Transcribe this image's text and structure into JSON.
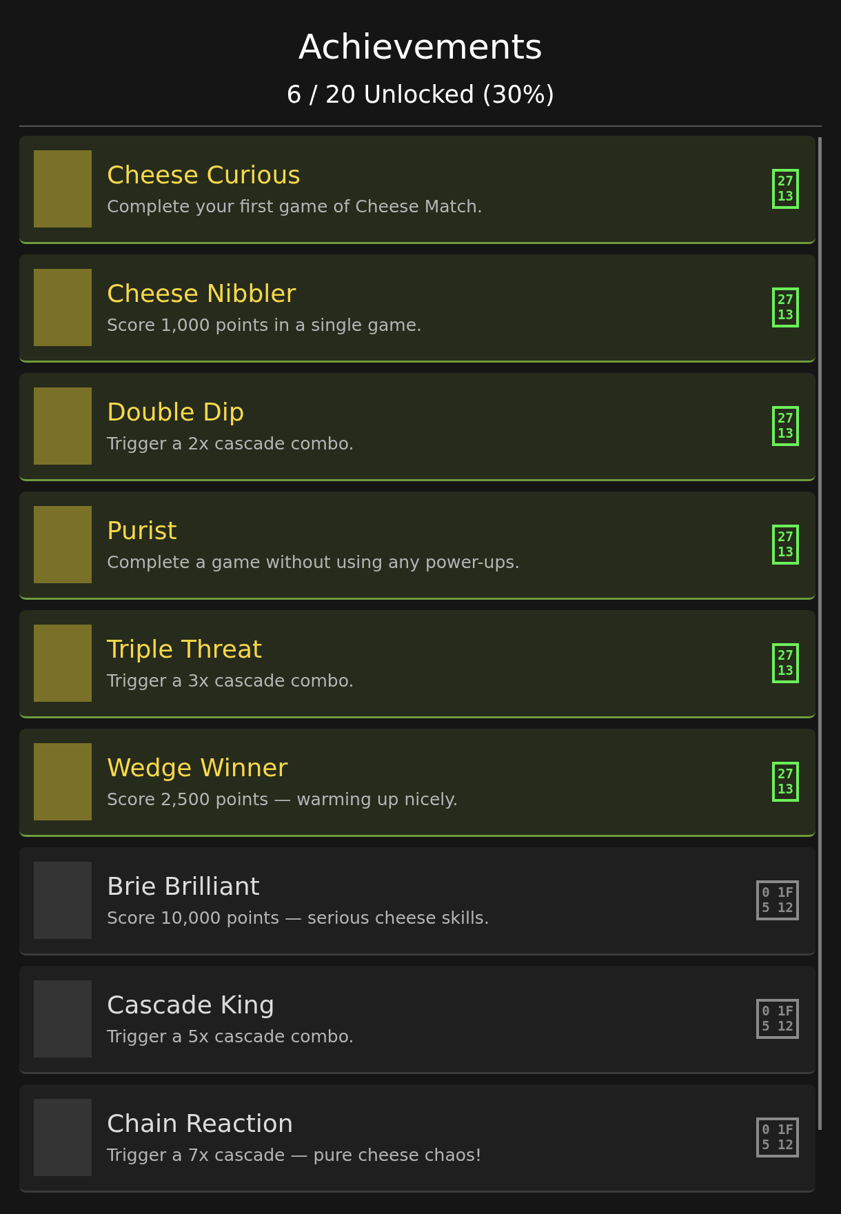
{
  "header": {
    "title": "Achievements",
    "progress": "6 / 20 Unlocked (30%)"
  },
  "achievements": [
    {
      "name": "Cheese Curious",
      "description": "Complete your first game of Cheese Match.",
      "unlocked": true,
      "glyph_code": [
        "27",
        "13"
      ]
    },
    {
      "name": "Cheese Nibbler",
      "description": "Score 1,000 points in a single game.",
      "unlocked": true,
      "glyph_code": [
        "27",
        "13"
      ]
    },
    {
      "name": "Double Dip",
      "description": "Trigger a 2x cascade combo.",
      "unlocked": true,
      "glyph_code": [
        "27",
        "13"
      ]
    },
    {
      "name": "Purist",
      "description": "Complete a game without using any power-ups.",
      "unlocked": true,
      "glyph_code": [
        "27",
        "13"
      ]
    },
    {
      "name": "Triple Threat",
      "description": "Trigger a 3x cascade combo.",
      "unlocked": true,
      "glyph_code": [
        "27",
        "13"
      ]
    },
    {
      "name": "Wedge Winner",
      "description": "Score 2,500 points — warming up nicely.",
      "unlocked": true,
      "glyph_code": [
        "27",
        "13"
      ]
    },
    {
      "name": "Brie Brilliant",
      "description": "Score 10,000 points — serious cheese skills.",
      "unlocked": false,
      "glyph_code": [
        "0 1F",
        "5 12"
      ]
    },
    {
      "name": "Cascade King",
      "description": "Trigger a 5x cascade combo.",
      "unlocked": false,
      "glyph_code": [
        "0 1F",
        "5 12"
      ]
    },
    {
      "name": "Chain Reaction",
      "description": "Trigger a 7x cascade — pure cheese chaos!",
      "unlocked": false,
      "glyph_code": [
        "0 1F",
        "5 12"
      ]
    }
  ]
}
